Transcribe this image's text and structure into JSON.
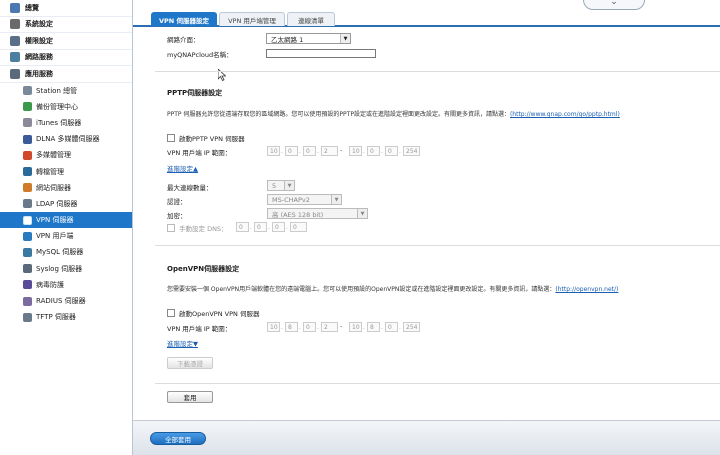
{
  "sidebar": {
    "top": [
      {
        "label": "總覽",
        "icon": "overview-icon",
        "color": "#4a78b0"
      },
      {
        "label": "系統設定",
        "icon": "gear-icon",
        "color": "#6a6a6a"
      },
      {
        "label": "權限設定",
        "icon": "user-icon",
        "color": "#5a6f88"
      },
      {
        "label": "網路服務",
        "icon": "globe-icon",
        "color": "#4a7fa0"
      },
      {
        "label": "應用服務",
        "icon": "app-service-icon",
        "color": "#5a6a7a"
      }
    ],
    "items": [
      {
        "label": "Station 總管",
        "icon": "station-icon",
        "color": "#7a8a9a"
      },
      {
        "label": "備份管理中心",
        "icon": "backup-icon",
        "color": "#3a9a4a"
      },
      {
        "label": "iTunes 伺服器",
        "icon": "itunes-icon",
        "color": "#8a8a9a"
      },
      {
        "label": "DLNA 多媒體伺服器",
        "icon": "dlna-icon",
        "color": "#3a5a9a"
      },
      {
        "label": "多媒體管理",
        "icon": "multimedia-icon",
        "color": "#d04a2a"
      },
      {
        "label": "轉檔管理",
        "icon": "transcode-icon",
        "color": "#2a6a9a"
      },
      {
        "label": "網站伺服器",
        "icon": "web-server-icon",
        "color": "#d07a2a"
      },
      {
        "label": "LDAP 伺服器",
        "icon": "ldap-icon",
        "color": "#6a7a8a"
      },
      {
        "label": "VPN 伺服器",
        "icon": "vpn-server-icon",
        "color": "#ffffff"
      },
      {
        "label": "VPN 用戶端",
        "icon": "vpn-client-icon",
        "color": "#2a7ac0"
      },
      {
        "label": "MySQL 伺服器",
        "icon": "mysql-icon",
        "color": "#3a7aa0"
      },
      {
        "label": "Syslog 伺服器",
        "icon": "syslog-icon",
        "color": "#5a6a7a"
      },
      {
        "label": "病毒防護",
        "icon": "antivirus-icon",
        "color": "#5a4a9a"
      },
      {
        "label": "RADIUS 伺服器",
        "icon": "radius-icon",
        "color": "#7a6aa0"
      },
      {
        "label": "TFTP 伺服器",
        "icon": "tftp-icon",
        "color": "#6a7a8a"
      }
    ],
    "active_index": 8
  },
  "tabs": [
    "VPN 伺服器設定",
    "VPN 用戶端管理",
    "連線清單"
  ],
  "general": {
    "interface_label": "網路介面：",
    "interface_value": "乙太網路 1",
    "myqnapcloud_label": "myQNAPcloud名稱："
  },
  "pptp": {
    "title": "PPTP伺服器設定",
    "desc": "PPTP 伺服器允許您從遠端存取您的區域網路。您可以使用預設的PPTP設定或在進階設定裡面更改設定。有關更多資訊，請點選：",
    "link": "(http://www.qnap.com/go/pptp.html)",
    "enable_label": "啟動PPTP VPN 伺服器",
    "ip_range_label": "VPN 用戶端 IP 範圍：",
    "ip_start": [
      "10",
      "0",
      "0",
      "2"
    ],
    "ip_end": [
      "10",
      "0",
      "0",
      "254"
    ],
    "advanced_label": "進階設定▲",
    "max_conn_label": "最大連線數量：",
    "max_conn_value": "5",
    "auth_label": "認證：",
    "auth_value": "MS-CHAPv2",
    "encrypt_label": "加密：",
    "encrypt_value": "高 (AES 128 bit)",
    "manual_dns_label": "手動設定 DNS：",
    "dns": [
      "0",
      "0",
      "0",
      "0"
    ]
  },
  "openvpn": {
    "title": "OpenVPN伺服器設定",
    "desc": "您需要安裝一個 OpenVPN用戶端軟體在您的遠端電腦上。您可以使用預設的OpenVPN設定或在進階設定裡面更改設定。有關更多資訊，請點選：",
    "link": "(http://openvpn.net/)",
    "enable_label": "啟動OpenVPN VPN 伺服器",
    "ip_range_label": "VPN 用戶端 IP 範圍：",
    "ip_start": [
      "10",
      "8",
      "0",
      "2"
    ],
    "ip_end": [
      "10",
      "8",
      "0",
      "254"
    ],
    "advanced_label": "進階設定▼",
    "download_label": "下載憑證"
  },
  "apply_label": "套用",
  "apply_all_label": "全部套用",
  "top_ctrl_icon": "⌄"
}
